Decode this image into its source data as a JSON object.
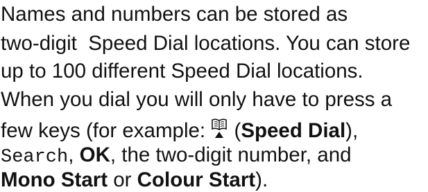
{
  "paragraph": {
    "line1": "Names and numbers can be stored as",
    "line2": "two-digit  Speed Dial locations. You can store",
    "line3": "up to 100 different Speed Dial locations.",
    "line4": "When you dial you will only have to press a",
    "line5": {
      "pre": "few keys (for example: ",
      "icon": "book-icon",
      "paren_open": " (",
      "speed_dial": "Speed Dial",
      "paren_close": "),"
    },
    "line6": {
      "search": "Search",
      "comma1": ", ",
      "ok": "OK",
      "rest": ", the two-digit number, and"
    },
    "line7": {
      "mono_start": "Mono Start",
      "or": " or ",
      "colour_start": "Colour Start",
      "end": ")."
    }
  }
}
